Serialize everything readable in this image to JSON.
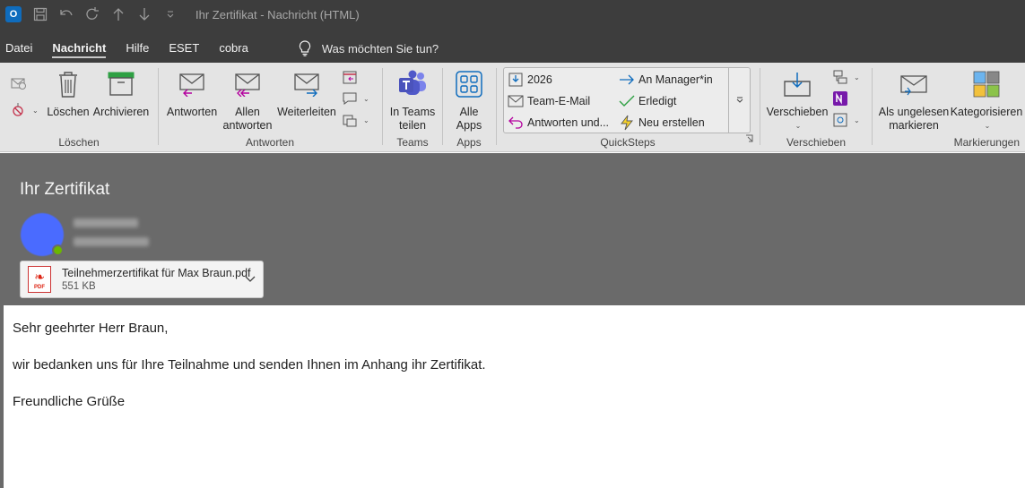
{
  "window": {
    "title": "Ihr Zertifikat  -  Nachricht (HTML)",
    "app_icon": "outlook-icon"
  },
  "menu": {
    "items": [
      "Datei",
      "Nachricht",
      "Hilfe",
      "ESET",
      "cobra"
    ],
    "active": "Nachricht",
    "tell_me": "Was möchten Sie tun?"
  },
  "ribbon": {
    "loeschen": {
      "label": "Löschen",
      "delete_label": "Löschen",
      "archive_label": "Archivieren"
    },
    "antworten": {
      "label": "Antworten",
      "reply_label": "Antworten",
      "reply_all_line1": "Allen",
      "reply_all_line2": "antworten",
      "forward_label": "Weiterleiten"
    },
    "teams": {
      "label": "Teams",
      "line1": "In Teams",
      "line2": "teilen"
    },
    "apps": {
      "label": "Apps",
      "line1": "Alle",
      "line2": "Apps"
    },
    "quicksteps": {
      "label": "QuickSteps",
      "items": [
        "2026",
        "Team-E-Mail",
        "Antworten und...",
        "An Manager*in",
        "Erledigt",
        "Neu erstellen"
      ]
    },
    "verschieben": {
      "label": "Verschieben",
      "move_label": "Verschieben"
    },
    "markierungen": {
      "label": "Markierungen",
      "unread_line1": "Als ungelesen",
      "unread_line2": "markieren",
      "categorize_label": "Kategorisieren"
    }
  },
  "message": {
    "subject": "Ihr Zertifikat",
    "attachment": {
      "name": "Teilnehmerzertifikat für Max Braun.pdf",
      "size": "551 KB"
    },
    "body": {
      "greeting": "Sehr geehrter Herr Braun,",
      "text": "wir bedanken uns für Ihre Teilnahme und senden Ihnen im Anhang ihr Zertifikat.",
      "closing": "Freundliche Grüße"
    }
  },
  "colors": {
    "titlebar": "#3d3d3d",
    "ribbon": "#e4e4e4",
    "header": "#6a6a6a",
    "accent": "#0f6cbd"
  }
}
